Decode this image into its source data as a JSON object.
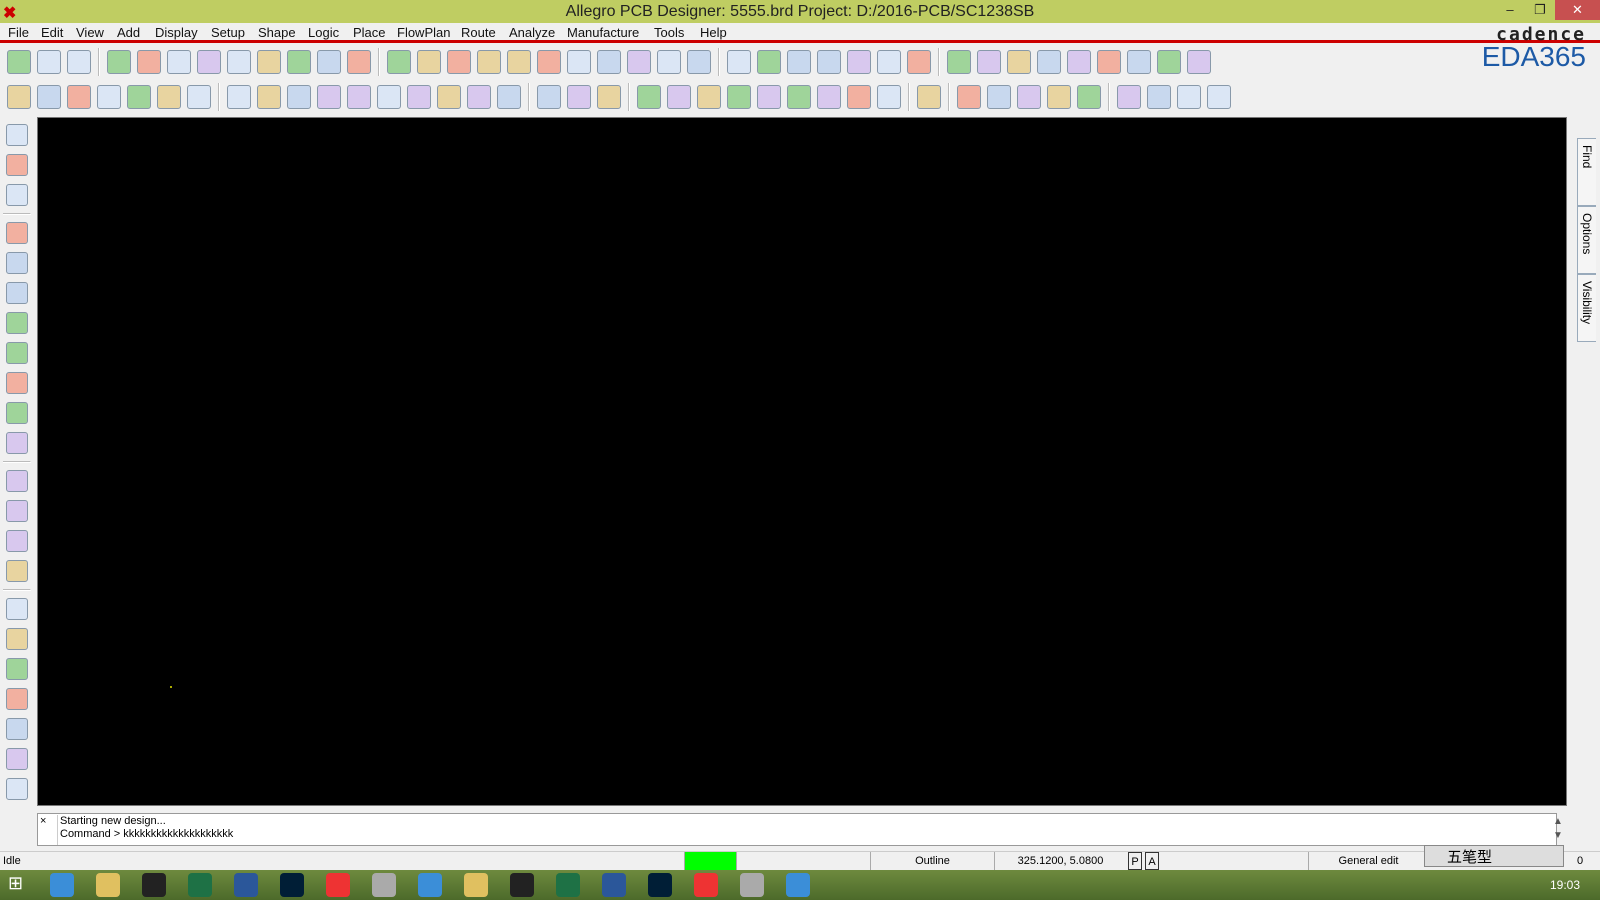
{
  "window": {
    "title": "Allegro PCB Designer: 5555.brd  Project: D:/2016-PCB/SC1238SB",
    "minimize": "–",
    "restore": "❐",
    "close": "✕"
  },
  "menu": [
    "File",
    "Edit",
    "View",
    "Add",
    "Display",
    "Setup",
    "Shape",
    "Logic",
    "Place",
    "FlowPlan",
    "Route",
    "Analyze",
    "Manufacture",
    "Tools",
    "Help"
  ],
  "logo": {
    "brand": "cadence",
    "sub": "EDA365"
  },
  "toolbar1": [
    "new-file",
    "open-folder",
    "save",
    "|",
    "move",
    "copy",
    "delete",
    "undo",
    "down-arrow",
    "redo",
    "down-arrow",
    "shape-green",
    "pin",
    "|",
    "unrats",
    "rats",
    "zoom-points",
    "zoom-fit",
    "zoom-in",
    "zoom-out",
    "zoom-world",
    "zoom-previous",
    "refresh",
    "3d-view",
    "flip",
    "|",
    "grid",
    "color",
    "layers",
    "layer-stack",
    "table",
    "spreadsheet",
    "display",
    "|",
    "info",
    "report",
    "measure",
    "highlight",
    "sun",
    "shadow",
    "column",
    "hourglass",
    "dehighlight"
  ],
  "toolbar2": [
    "board-outline",
    "component",
    "connect",
    "net",
    "constraint",
    "grey-box",
    "corner",
    "|",
    "shape-poly",
    "rect",
    "circle",
    "select",
    "merge",
    "void-circle",
    "void-rect",
    "void-round",
    "edit-boundary",
    "delete-void",
    "|",
    "testpoint",
    "dimension",
    "dimension-linear",
    "|",
    "odb",
    "stack",
    "wrench",
    "camera",
    "renumber",
    "flag",
    "matrix",
    "tag",
    "array",
    "|",
    "wave",
    "|",
    "doc1",
    "book",
    "cmgr",
    "check",
    "probe",
    "|",
    "export",
    "mail",
    "mail2",
    "help"
  ],
  "left_toolbar": [
    "place-manual",
    "u1",
    "quickplace",
    "|",
    "add-connect",
    "slide",
    "delay-tune",
    "custom-smooth",
    "spread",
    "fanout",
    "vias",
    "hybrid",
    "|",
    "line",
    "rectangle",
    "text-add",
    "text-edit",
    "|",
    "route1",
    "route2",
    "route3",
    "route4",
    "route5",
    "route6",
    "route7"
  ],
  "right_tabs": [
    "Find",
    "Options",
    "Visibility"
  ],
  "command": {
    "close": "×",
    "line1": "Starting new design...",
    "line2": "Command > kkkkkkkkkkkkkkkkkkkk",
    "scroll_up": "▲",
    "scroll_down": "▼"
  },
  "status": {
    "state": "Idle",
    "indicator_color": "#00ff00",
    "subclass": "Outline",
    "coords": "325.1200, 5.0800",
    "p": "P",
    "a": "A",
    "mode": "General edit",
    "count": "0"
  },
  "ime": {
    "text": "五笔型"
  },
  "taskbar": {
    "apps": [
      "ie",
      "explorer",
      "qq",
      "excel",
      "word",
      "photoshop",
      "netease",
      "app1",
      "notes",
      "app2",
      "app3",
      "app4",
      "app5",
      "app6",
      "app7",
      "allegro",
      "app8"
    ],
    "time": "19:03"
  }
}
